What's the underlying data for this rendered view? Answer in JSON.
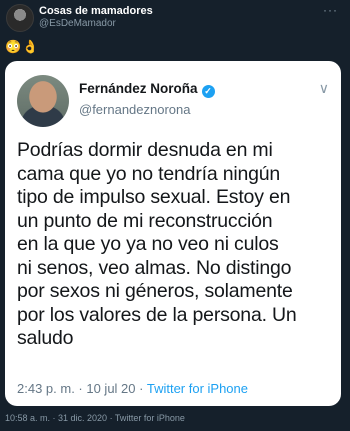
{
  "outer_tweet": {
    "author_name": "Cosas de mamadores",
    "author_handle": "@EsDeMamador",
    "more_glyph": "···",
    "emojis": [
      "😳",
      "👌"
    ],
    "timestamp": "10:58 a. m. · 31 dic. 2020 · Twitter for iPhone"
  },
  "quoted_tweet": {
    "author_name": "Fernández Noroña",
    "author_handle": "@fernandeznorona",
    "verified_glyph": "✓",
    "chevron_glyph": "∨",
    "text_lines": [
      "Podrías dormir desnuda en mi",
      "cama que yo no tendría ningún",
      "tipo de impulso sexual. Estoy en",
      "un punto de mi reconstrucción",
      "en la que yo ya no veo ni culos",
      "ni senos, veo almas. No distingo",
      "por sexos ni géneros, solamente",
      "por los valores de la persona. Un",
      "saludo"
    ],
    "time_date": "2:43 p. m. · 10 jul 20 · ",
    "source": "Twitter for iPhone"
  },
  "colors": {
    "background": "#15202b",
    "card": "#ffffff",
    "link": "#1da1f2",
    "muted": "#657786"
  }
}
